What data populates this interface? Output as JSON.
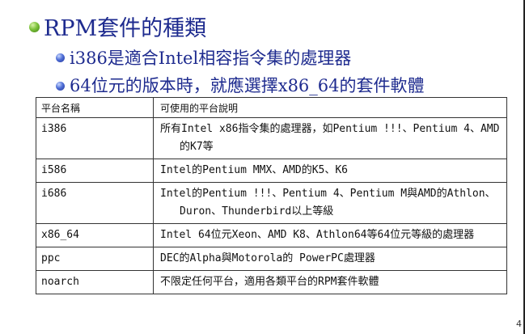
{
  "title": "RPM套件的種類",
  "bullets": [
    "i386是適合Intel相容指令集的處理器",
    "64位元的版本時，就應選擇x86_64的套件軟體"
  ],
  "table": {
    "headers": [
      "平台名稱",
      "可使用的平台說明"
    ],
    "rows": [
      {
        "platform": "i386",
        "desc": "所有Intel x86指令集的處理器，如Pentium !!!、Pentium 4、AMD的K7等"
      },
      {
        "platform": "i586",
        "desc": "Intel的Pentium MMX、AMD的K5、K6"
      },
      {
        "platform": "i686",
        "desc": "Intel的Pentium !!!、Pentium 4、Pentium M與AMD的Athlon、Duron、Thunderbird以上等級"
      },
      {
        "platform": "x86_64",
        "desc": "Intel 64位元Xeon、AMD K8、Athlon64等64位元等級的處理器"
      },
      {
        "platform": "ppc",
        "desc": "DEC的Alpha與Motorola的 PowerPC處理器"
      },
      {
        "platform": "noarch",
        "desc": "不限定任何平台，適用各類平台的RPM套件軟體"
      }
    ]
  },
  "page_number": "4",
  "colors": {
    "title": "#1e2b8f",
    "bullet_level1": "#5fa823",
    "bullet_level2": "#2f44b5"
  }
}
